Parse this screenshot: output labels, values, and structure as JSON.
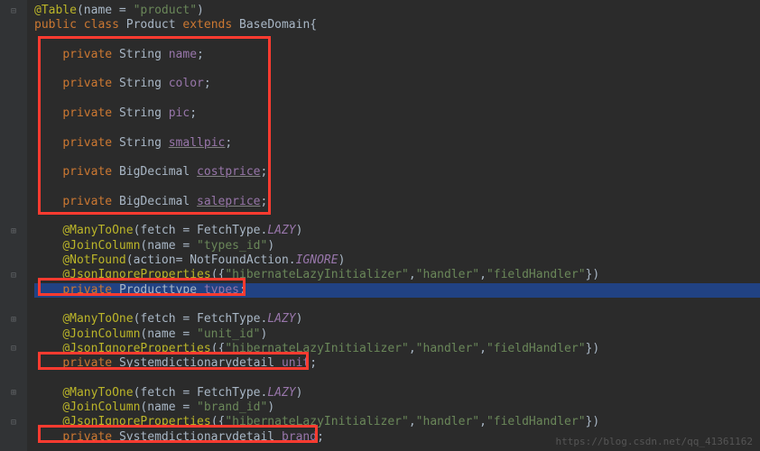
{
  "annotation": {
    "table": "@Table",
    "manyToOne": "@ManyToOne",
    "joinColumn": "@JoinColumn",
    "notFound": "@NotFound",
    "jsonIgnore": "@JsonIgnoreProperties"
  },
  "kw": {
    "public": "public",
    "class": "class",
    "extends": "extends",
    "private": "private"
  },
  "cls": {
    "product": "Product",
    "baseDomain": "BaseDomain",
    "string": "String",
    "bigDecimal": "BigDecimal",
    "productType": "Producttype",
    "sysDict": "Systemdictionarydetail",
    "fetchType": "FetchType",
    "notFoundAction": "NotFoundAction"
  },
  "fields": {
    "name": "name",
    "color": "color",
    "pic": "pic",
    "smallpic": "smallpic",
    "costprice": "costprice",
    "saleprice": "saleprice",
    "types": "types",
    "unit": "unit",
    "brand": "brand"
  },
  "strings": {
    "product": "\"product\"",
    "typesId": "\"types_id\"",
    "unitId": "\"unit_id\"",
    "brandId": "\"brand_id\"",
    "hib": "\"hibernateLazyInitializer\"",
    "handler": "\"handler\"",
    "fieldHandler": "\"fieldHandler\""
  },
  "enums": {
    "lazy": "LAZY",
    "ignore": "IGNORE"
  },
  "labels": {
    "nameAttr": "name",
    "fetchAttr": "fetch",
    "actionAttr": "action"
  },
  "watermark": "https://blog.csdn.net/qq_41361162"
}
